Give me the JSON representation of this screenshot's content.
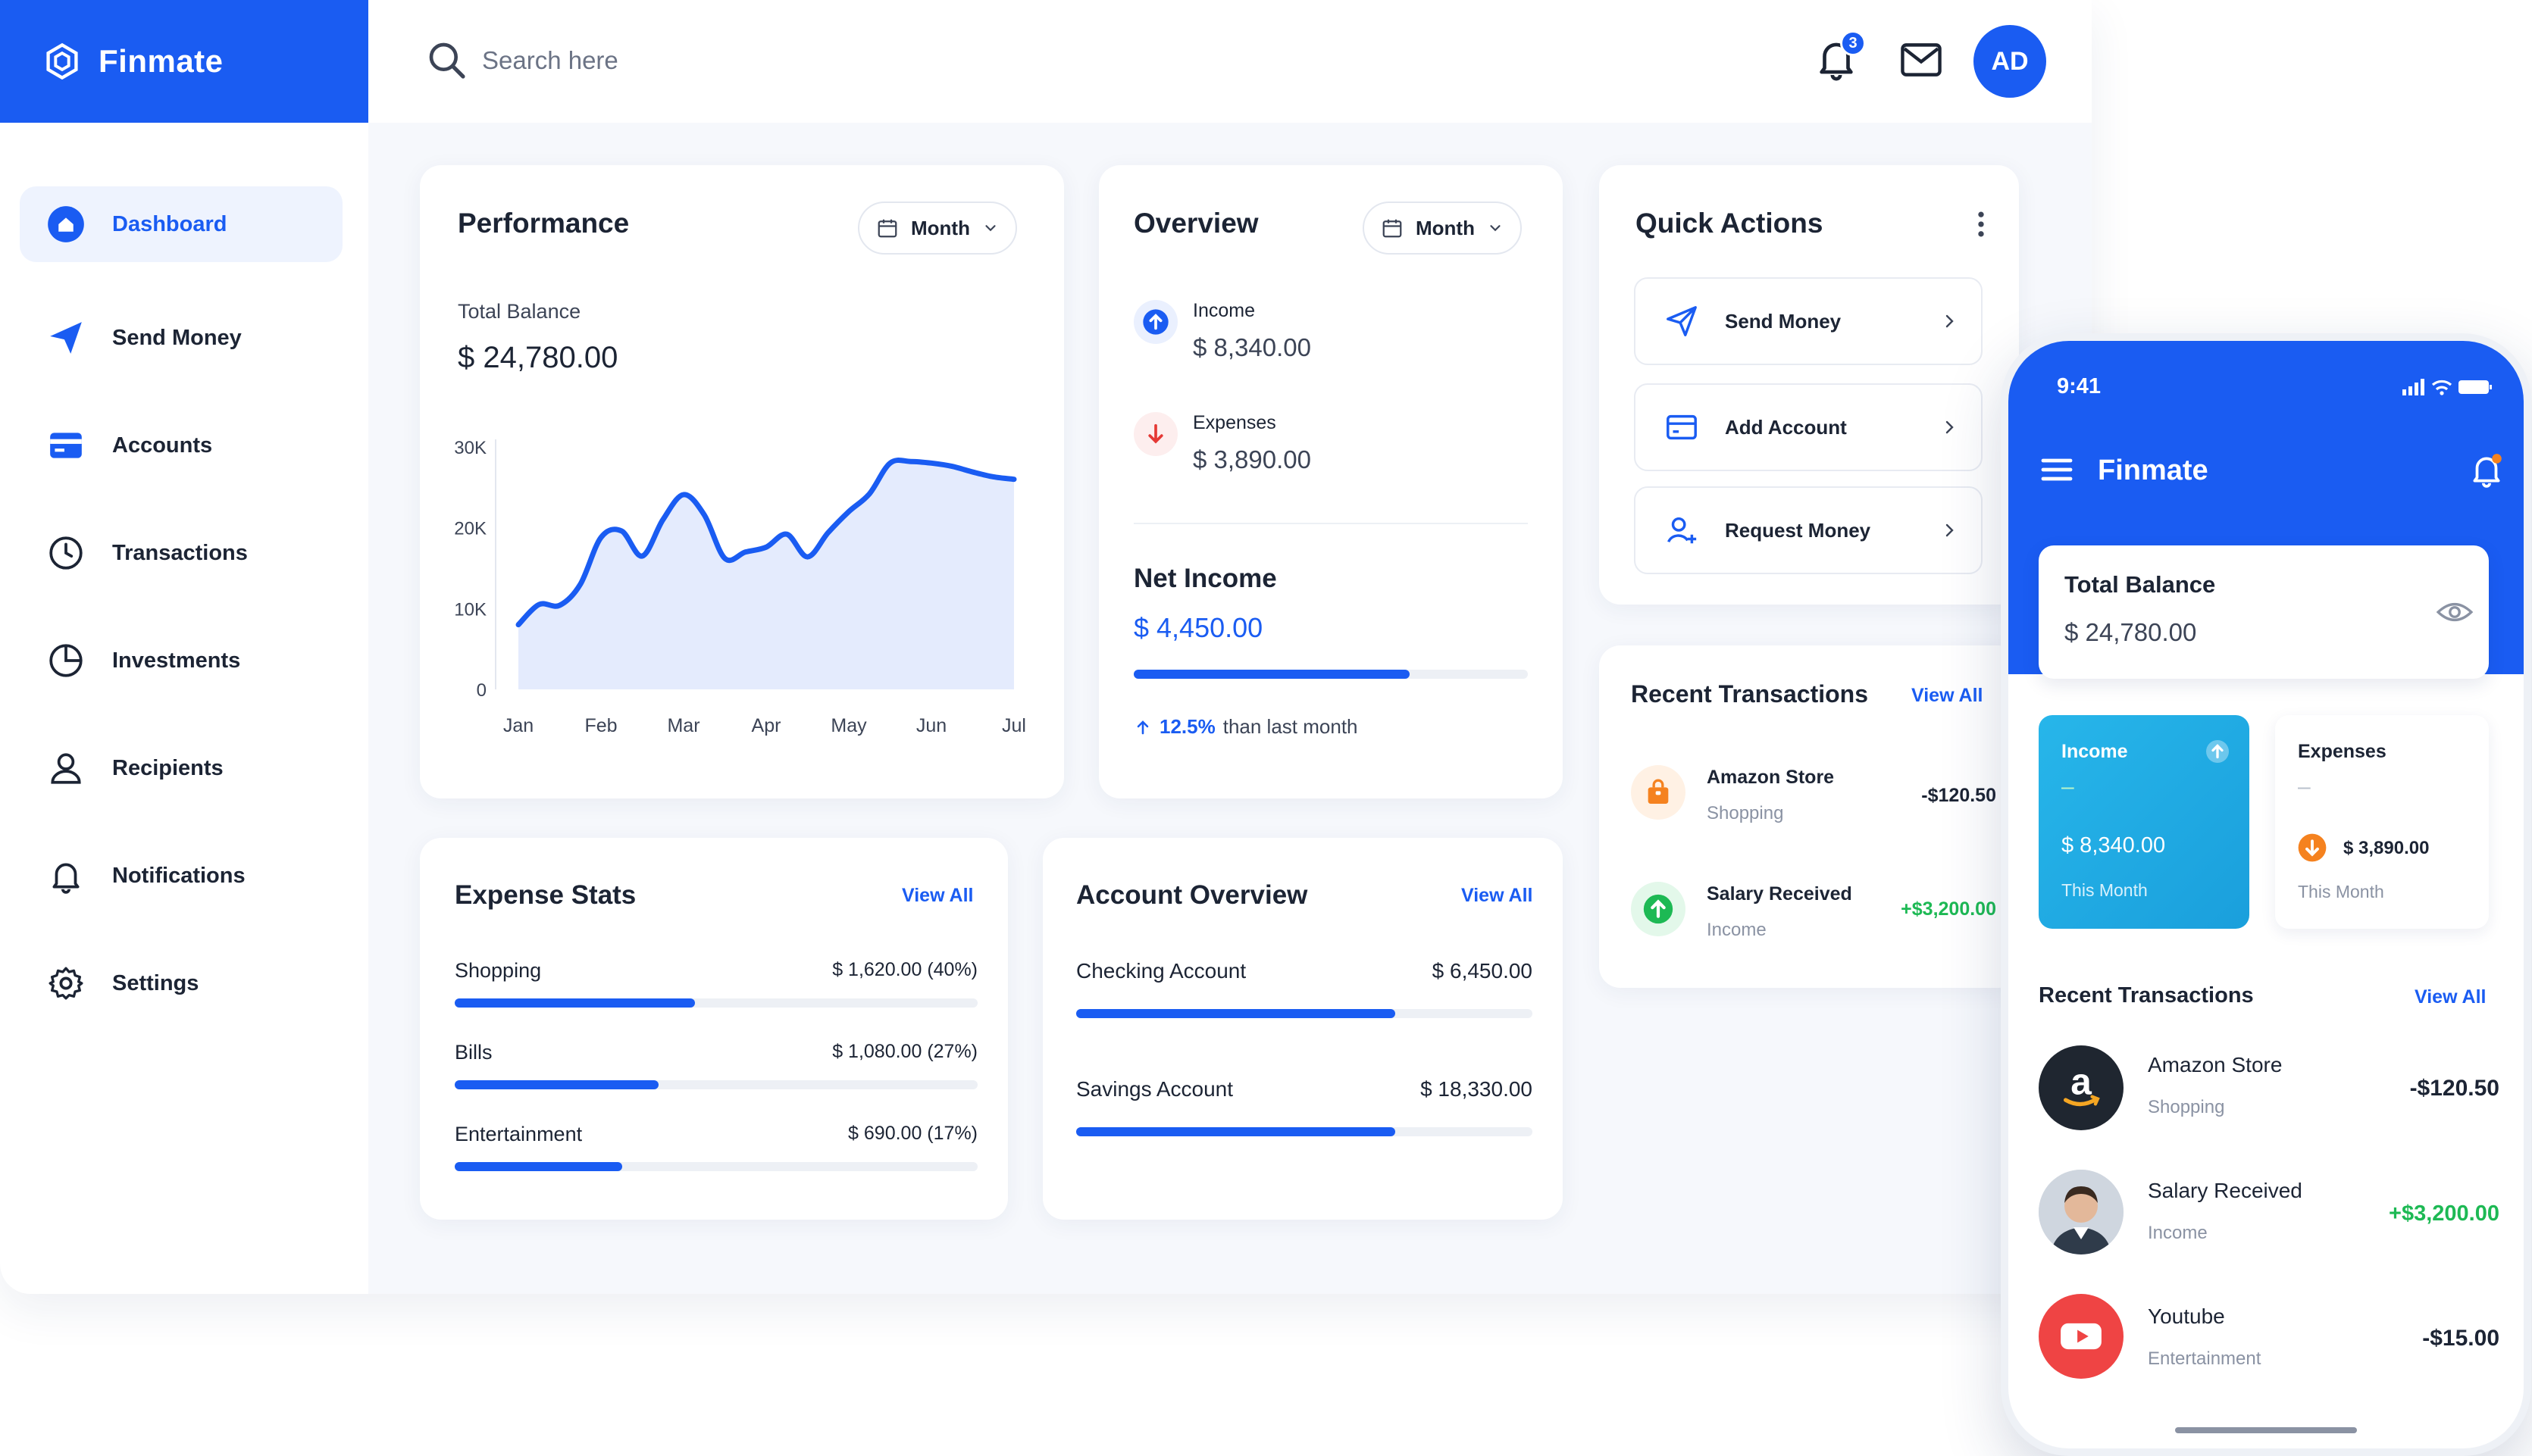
{
  "app": {
    "name": "Finmate"
  },
  "search": {
    "placeholder": "Search here"
  },
  "header": {
    "notification_count": "3",
    "avatar_initials": "AD"
  },
  "sidebar": {
    "items": [
      {
        "label": "Dashboard",
        "icon": "dashboard-icon",
        "active": true
      },
      {
        "label": "Send Money",
        "icon": "send-icon"
      },
      {
        "label": "Accounts",
        "icon": "card-icon"
      },
      {
        "label": "Transactions",
        "icon": "clock-icon"
      },
      {
        "label": "Investments",
        "icon": "pie-icon"
      },
      {
        "label": "Recipients",
        "icon": "user-icon"
      },
      {
        "label": "Notifications",
        "icon": "bell-icon"
      },
      {
        "label": "Settings",
        "icon": "gear-icon"
      }
    ]
  },
  "performance": {
    "title": "Performance",
    "period": "Month",
    "balance_label": "Total Balance",
    "balance_value": "$ 24,780.00"
  },
  "chart_data": {
    "type": "area",
    "categories": [
      "Jan",
      "Feb",
      "Mar",
      "Apr",
      "May",
      "Jun",
      "Jul"
    ],
    "x": [
      0,
      0.25,
      0.5,
      0.75,
      1,
      1.25,
      1.5,
      1.75,
      2,
      2.25,
      2.5,
      2.75,
      3,
      3.25,
      3.5,
      3.75,
      4,
      4.25,
      4.5,
      4.75,
      5,
      5.25,
      5.5,
      5.75,
      6
    ],
    "values": [
      8000,
      10500,
      10400,
      13000,
      18800,
      19600,
      16500,
      21000,
      24100,
      21600,
      16200,
      17000,
      17600,
      19200,
      16400,
      19400,
      22000,
      24200,
      28000,
      28200,
      28000,
      27600,
      26900,
      26300,
      26000
    ],
    "ylim": [
      0,
      30000
    ],
    "yticks": [
      "30K",
      "20K",
      "10K",
      "0"
    ],
    "ytick_values": [
      30000,
      20000,
      10000,
      0
    ],
    "colors": {
      "line": "#1a5cf2",
      "fill": "#dfe8fd"
    },
    "grid": false
  },
  "overview": {
    "title": "Overview",
    "period": "Month",
    "income_label": "Income",
    "income_value": "$ 8,340.00",
    "expenses_label": "Expenses",
    "expenses_value": "$ 3,890.00",
    "net_label": "Net Income",
    "net_value": "$ 4,450.00",
    "net_progress": 0.7,
    "change_value": "12.5%",
    "change_text": "than last month"
  },
  "quick_actions": {
    "title": "Quick Actions",
    "items": [
      {
        "label": "Send Money",
        "icon": "send-icon"
      },
      {
        "label": "Add Account",
        "icon": "card-icon"
      },
      {
        "label": "Request Money",
        "icon": "user-add-icon"
      }
    ]
  },
  "recent_transactions": {
    "title": "Recent Transactions",
    "view_all": "View All",
    "items": [
      {
        "name": "Amazon Store",
        "category": "Shopping",
        "amount": "-$120.50",
        "icon": "bag-icon",
        "color": "#f5821f"
      },
      {
        "name": "Salary Received",
        "category": "Income",
        "amount": "+$3,200.00",
        "icon": "arrow-up-icon",
        "color": "#1db954"
      }
    ]
  },
  "expense_stats": {
    "title": "Expense Stats",
    "view_all": "View All",
    "items": [
      {
        "label": "Shopping",
        "value": "$ 1,620.00 (40%)",
        "fraction": 0.46
      },
      {
        "label": "Bills",
        "value": "$ 1,080.00 (27%)",
        "fraction": 0.39
      },
      {
        "label": "Entertainment",
        "value": "$ 690.00 (17%)",
        "fraction": 0.32
      }
    ]
  },
  "account_overview": {
    "title": "Account Overview",
    "view_all": "View All",
    "items": [
      {
        "label": "Checking Account",
        "value": "$ 6,450.00",
        "fraction": 0.7
      },
      {
        "label": "Savings Account",
        "value": "$ 18,330.00",
        "fraction": 0.7
      }
    ]
  },
  "phone": {
    "time": "9:41",
    "app_name": "Finmate",
    "balance_label": "Total Balance",
    "balance_value": "$ 24,780.00",
    "income_label": "Income",
    "income_dash": "–",
    "income_value": "$ 8,340.00",
    "income_period": "This Month",
    "expenses_label": "Expenses",
    "expenses_dash": "–",
    "expenses_value": "$ 3,890.00",
    "expenses_period": "This Month",
    "transactions_title": "Recent Transactions",
    "view_all": "View All",
    "transactions": [
      {
        "name": "Amazon Store",
        "category": "Shopping",
        "amount": "-$120.50",
        "icon": "amazon-icon"
      },
      {
        "name": "Salary Received",
        "category": "Income",
        "amount": "+$3,200.00",
        "icon": "person-avatar"
      },
      {
        "name": "Youtube",
        "category": "Entertainment",
        "amount": "-$15.00",
        "icon": "youtube-icon"
      }
    ],
    "colors": {
      "brand": "#1a5cf2",
      "income_card": "#1eaee6",
      "positive": "#1db954",
      "negative": "#1c2434"
    }
  }
}
